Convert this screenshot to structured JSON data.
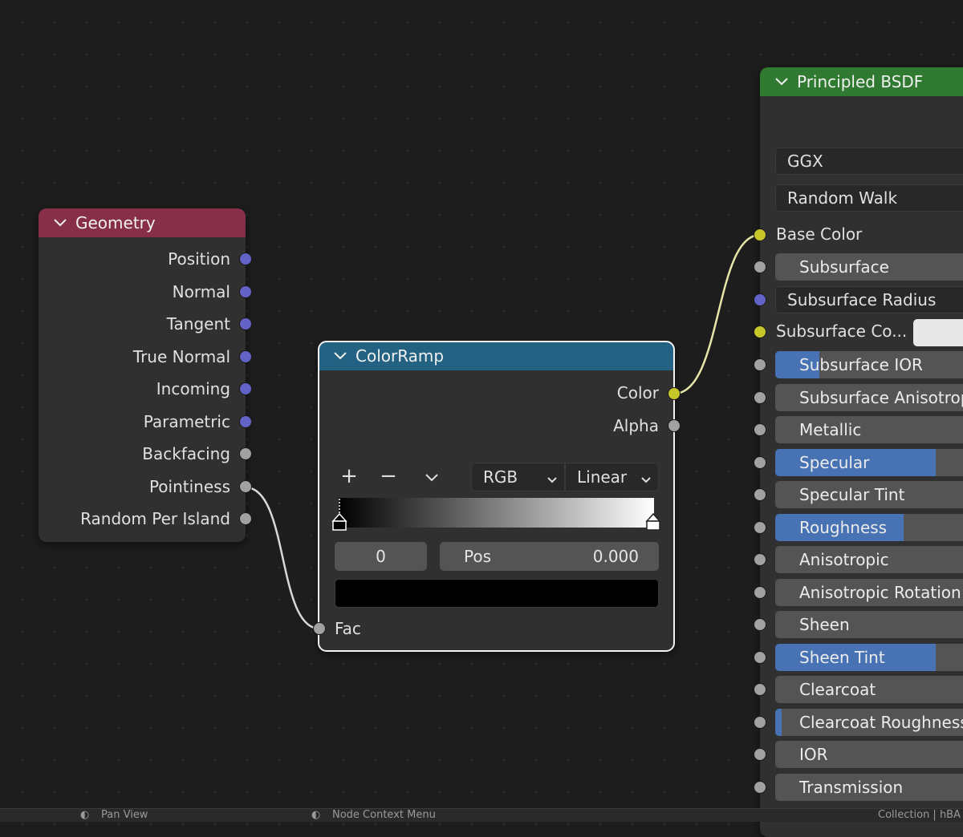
{
  "geometry_node": {
    "title": "Geometry",
    "outputs": [
      "Position",
      "Normal",
      "Tangent",
      "True Normal",
      "Incoming",
      "Parametric",
      "Backfacing",
      "Pointiness",
      "Random Per Island"
    ]
  },
  "colorramp_node": {
    "title": "ColorRamp",
    "outputs": [
      "Color",
      "Alpha"
    ],
    "add_label": "+",
    "remove_label": "−",
    "color_mode": "RGB",
    "interpolation": "Linear",
    "stop_index": "0",
    "pos_label": "Pos",
    "pos_value": "0.000",
    "input_label": "Fac"
  },
  "bsdf_node": {
    "title": "Principled BSDF",
    "distribution": "GGX",
    "subsurface_method": "Random Walk",
    "base_color_label": "Base Color",
    "subsurface_label": "Subsurface",
    "subsurface_radius_label": "Subsurface Radius",
    "subsurface_color_label": "Subsurface Co...",
    "sliders": [
      {
        "label": "Subsurface IOR",
        "fill": 0.22
      },
      {
        "label": "Subsurface Anisotropy",
        "fill": 0
      },
      {
        "label": "Metallic",
        "fill": 0
      },
      {
        "label": "Specular",
        "fill": 0.8
      },
      {
        "label": "Specular Tint",
        "fill": 0
      },
      {
        "label": "Roughness",
        "fill": 0.64
      },
      {
        "label": "Anisotropic",
        "fill": 0
      },
      {
        "label": "Anisotropic Rotation",
        "fill": 0
      },
      {
        "label": "Sheen",
        "fill": 0
      },
      {
        "label": "Sheen Tint",
        "fill": 0.8
      },
      {
        "label": "Clearcoat",
        "fill": 0
      },
      {
        "label": "Clearcoat Roughness",
        "fill": 0.03
      },
      {
        "label": "IOR",
        "fill": 0
      },
      {
        "label": "Transmission",
        "fill": 0
      }
    ]
  },
  "status_bar": {
    "item1": "Pan View",
    "item2": "Node Context Menu",
    "item3": "Collection | hBA"
  },
  "colors": {
    "geometry_header": "#872f48",
    "colorramp_header": "#246283",
    "bsdf_header": "#2f7a30",
    "vector_socket": "#6363c7",
    "float_socket": "#a1a1a1",
    "color_socket": "#c7c729",
    "slider_fill": "#4772b3"
  }
}
